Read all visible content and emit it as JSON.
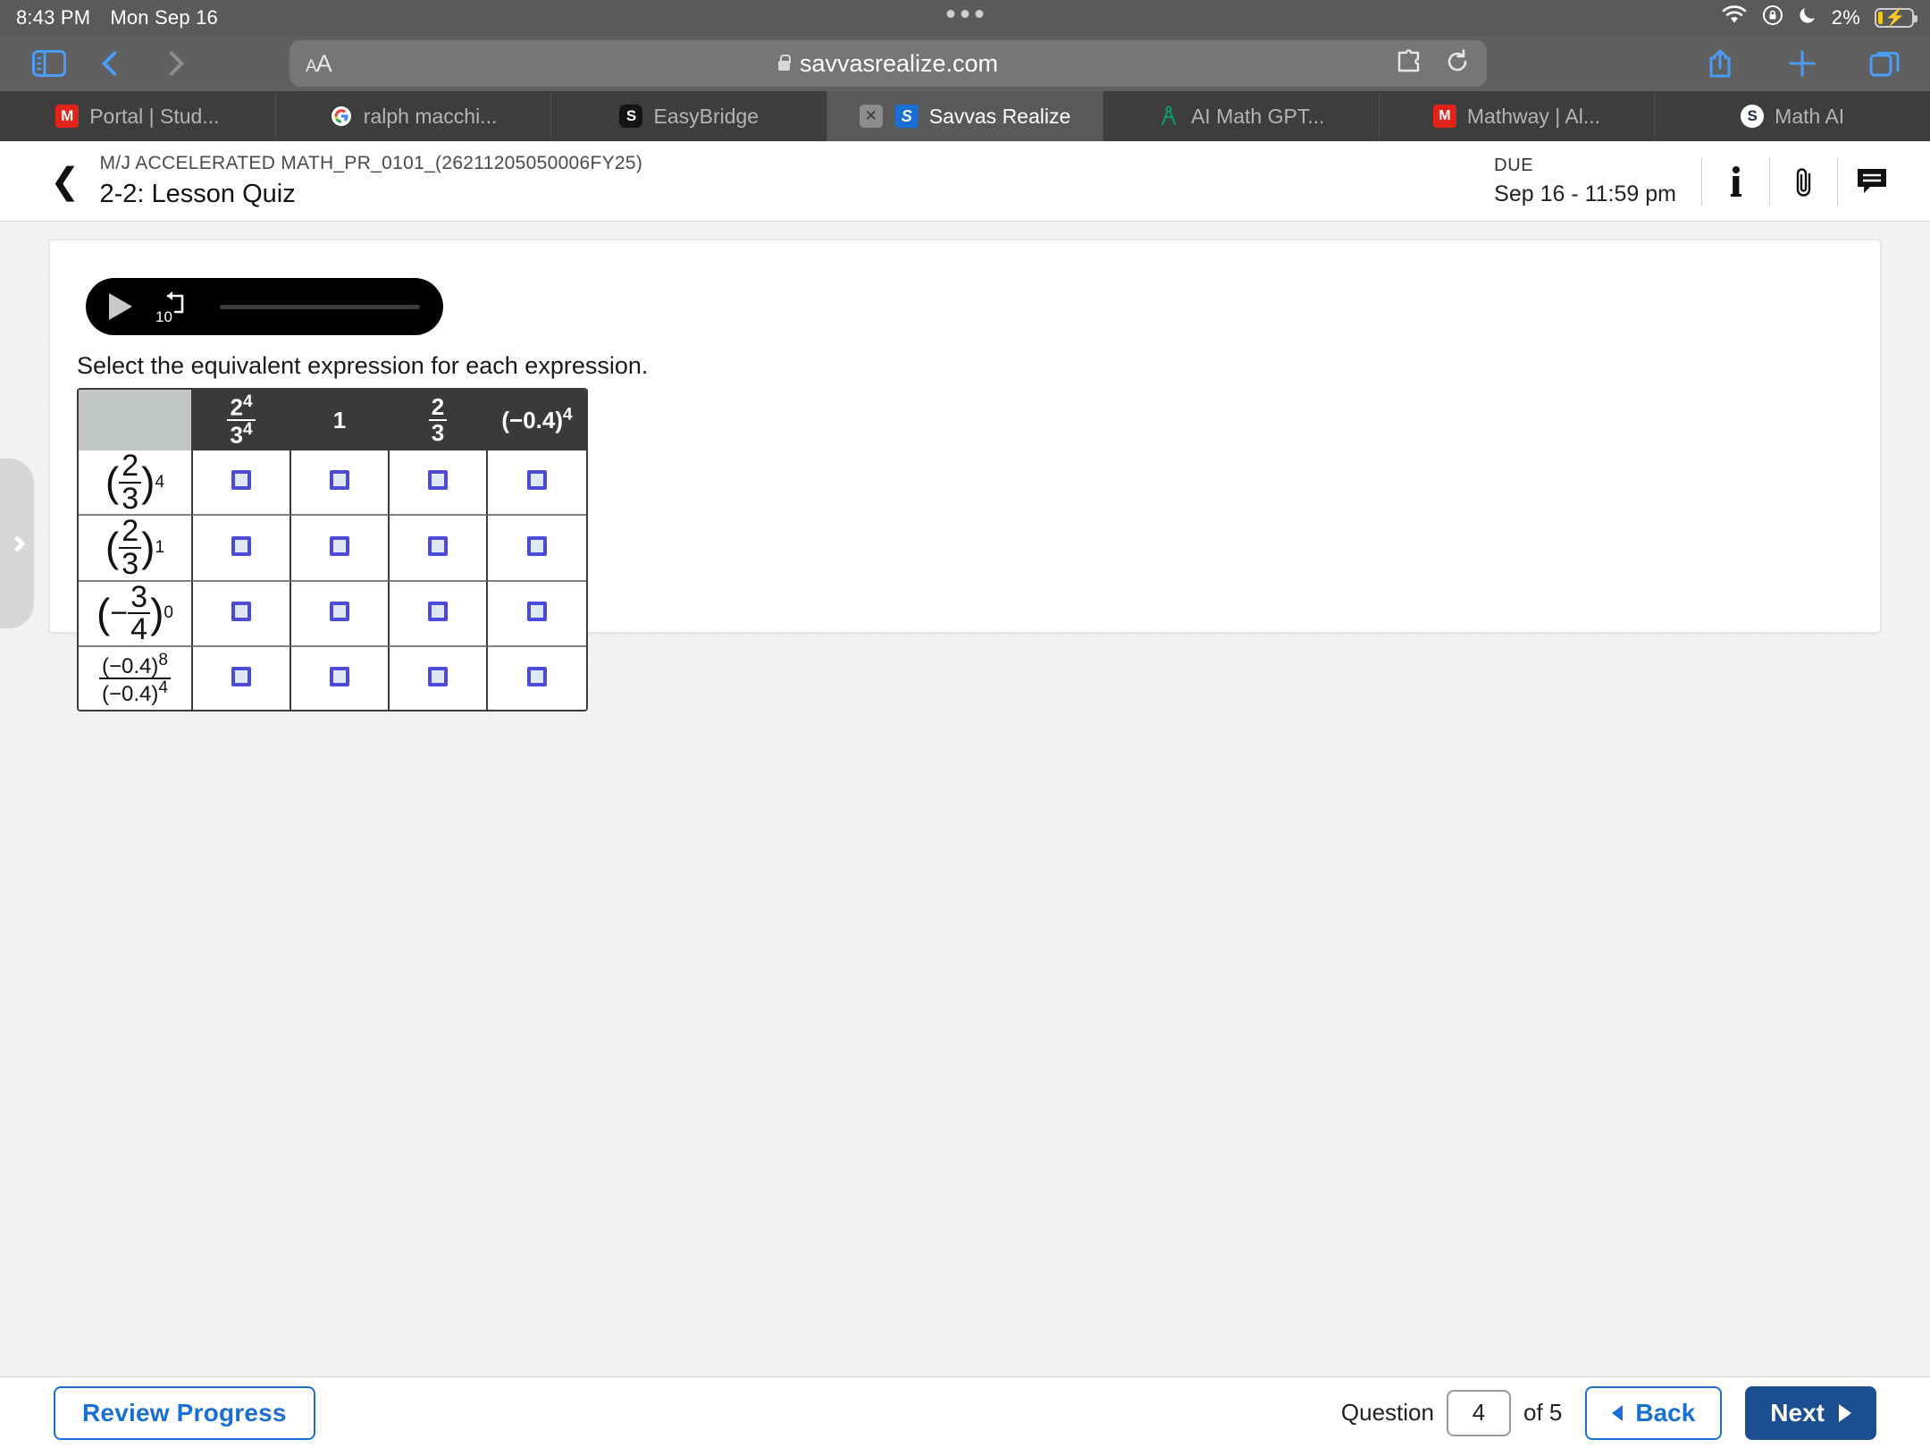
{
  "statusbar": {
    "time": "8:43 PM",
    "date": "Mon Sep 16",
    "battery_percent": "2%",
    "icons": [
      "wifi-icon",
      "rotation-lock-icon",
      "do-not-disturb-moon-icon",
      "battery-charging-icon"
    ]
  },
  "browser": {
    "sidebar_icon": "sidebar-icon",
    "back_icon": "back-chevron-icon",
    "forward_icon": "forward-chevron-icon",
    "text_size_label": "A",
    "text_size_label_big": "A",
    "url": "savvasrealize.com",
    "lock_icon": "lock-icon",
    "extensions_icon": "puzzle-piece-icon",
    "reload_icon": "reload-icon",
    "share_icon": "share-icon",
    "new_tab_icon": "plus-icon",
    "tabs_overview_icon": "tab-overview-icon",
    "tabs": [
      {
        "title": "Portal | Stud...",
        "favicon": "portal-favicon",
        "favicon_letter": "M",
        "active": false,
        "closable": false
      },
      {
        "title": "ralph macchi...",
        "favicon": "google-favicon",
        "favicon_letter": "G",
        "active": false,
        "closable": false
      },
      {
        "title": "EasyBridge",
        "favicon": "easybridge-favicon",
        "favicon_letter": "S",
        "active": false,
        "closable": false
      },
      {
        "title": "Savvas Realize",
        "favicon": "savvas-favicon",
        "favicon_letter": "S",
        "active": true,
        "closable": true
      },
      {
        "title": "AI Math GPT...",
        "favicon": "compass-favicon",
        "favicon_letter": "A",
        "active": false,
        "closable": false
      },
      {
        "title": "Mathway | Al...",
        "favicon": "mathway-favicon",
        "favicon_letter": "M",
        "active": false,
        "closable": false
      },
      {
        "title": "Math AI",
        "favicon": "mathai-favicon",
        "favicon_letter": "S",
        "active": false,
        "closable": false
      }
    ]
  },
  "page_header": {
    "back_icon": "back-chevron-icon",
    "course_code": "M/J ACCELERATED MATH_PR_0101_(26211205050006FY25)",
    "lesson_title": "2-2: Lesson Quiz",
    "due_label": "DUE",
    "due_date": "Sep 16 - 11:59 pm",
    "info_icon": "info-icon",
    "attachment_icon": "paperclip-icon",
    "comment_icon": "comment-icon"
  },
  "audio_player": {
    "play_icon": "play-icon",
    "rewind_icon": "rewind-10-icon",
    "rewind_seconds": "10"
  },
  "question": {
    "prompt": "Select the equivalent expression for each expression.",
    "table": {
      "corner_header": "",
      "column_headers": [
        {
          "type": "fraction_power",
          "numerator": "2",
          "num_exp": "4",
          "denominator": "3",
          "den_exp": "4",
          "text": "2^4/3^4"
        },
        {
          "type": "plain",
          "text": "1"
        },
        {
          "type": "fraction",
          "numerator": "2",
          "denominator": "3",
          "text": "2/3"
        },
        {
          "type": "plain_power",
          "base": "(−0.4)",
          "exponent": "4",
          "text": "(−0.4)^4"
        }
      ],
      "rows": [
        {
          "label": {
            "type": "paren_fraction",
            "numerator": "2",
            "denominator": "3",
            "exponent": "4",
            "text": "(2/3)^4"
          },
          "checkboxes": [
            false,
            false,
            false,
            false
          ]
        },
        {
          "label": {
            "type": "paren_fraction",
            "numerator": "2",
            "denominator": "3",
            "exponent": "1",
            "text": "(2/3)^1"
          },
          "checkboxes": [
            false,
            false,
            false,
            false
          ]
        },
        {
          "label": {
            "type": "paren_fraction_neg",
            "numerator": "3",
            "denominator": "4",
            "exponent": "0",
            "text": "(−3/4)^0"
          },
          "checkboxes": [
            false,
            false,
            false,
            false
          ]
        },
        {
          "label": {
            "type": "quotient_powers",
            "numerator": "(−0.4)",
            "num_exp": "8",
            "denominator": "(−0.4)",
            "den_exp": "4",
            "text": "(−0.4)^8 / (−0.4)^4"
          },
          "checkboxes": [
            false,
            false,
            false,
            false
          ]
        }
      ]
    }
  },
  "drawer": {
    "handle_icon": "chevron-right-icon"
  },
  "bottombar": {
    "review_progress_label": "Review Progress",
    "question_label": "Question",
    "question_number": "4",
    "of_label": "of 5",
    "back_label": "Back",
    "next_label": "Next"
  },
  "colors": {
    "accent_blue": "#1a6fd4",
    "next_navy": "#1b4f91",
    "safari_chrome": "#606060",
    "tabstrip": "#3d3d3d",
    "checkbox_border": "#4b4bd8"
  }
}
